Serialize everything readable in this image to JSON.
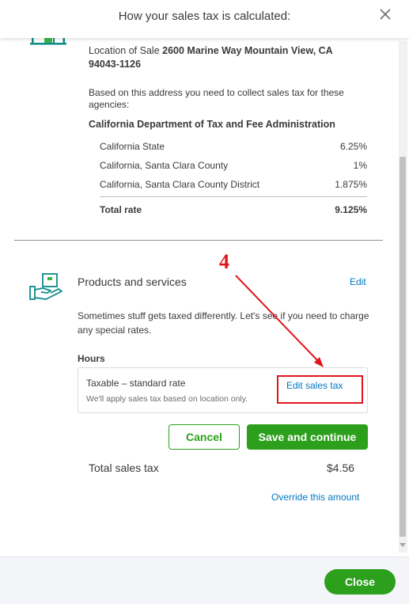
{
  "header": {
    "title": "How your sales tax is calculated:"
  },
  "location": {
    "label": "Location of Sale",
    "address": "2600 Marine Way Mountain View, CA 94043-1126"
  },
  "agencies_intro": "Based on this address you need to collect sales tax for these agencies:",
  "agency_name": "California Department of Tax and Fee Administration",
  "rates": [
    {
      "name": "California State",
      "rate": "6.25%"
    },
    {
      "name": "California, Santa Clara County",
      "rate": "1%"
    },
    {
      "name": "California, Santa Clara County District",
      "rate": "1.875%"
    }
  ],
  "total_rate": {
    "label": "Total rate",
    "value": "9.125%"
  },
  "products": {
    "title": "Products and services",
    "edit_label": "Edit",
    "description": "Sometimes stuff gets taxed differently. Let's see if you need to charge any special rates.",
    "item_label": "Hours",
    "tax_type": "Taxable – standard rate",
    "tax_note": "We'll apply sales tax based on location only.",
    "edit_tax_label": "Edit sales tax"
  },
  "annotation": {
    "step_number": "4"
  },
  "buttons": {
    "cancel": "Cancel",
    "save": "Save and continue",
    "close": "Close"
  },
  "total_sales_tax": {
    "label": "Total sales tax",
    "value": "$4.56"
  },
  "override_label": "Override this amount",
  "colors": {
    "brand_green": "#2ca01c",
    "link_blue": "#0077c5",
    "annotation_red": "#e0161c",
    "icon_teal": "#0d8a8a"
  },
  "icons": [
    "close-icon",
    "store-icon",
    "hand-box-icon"
  ]
}
